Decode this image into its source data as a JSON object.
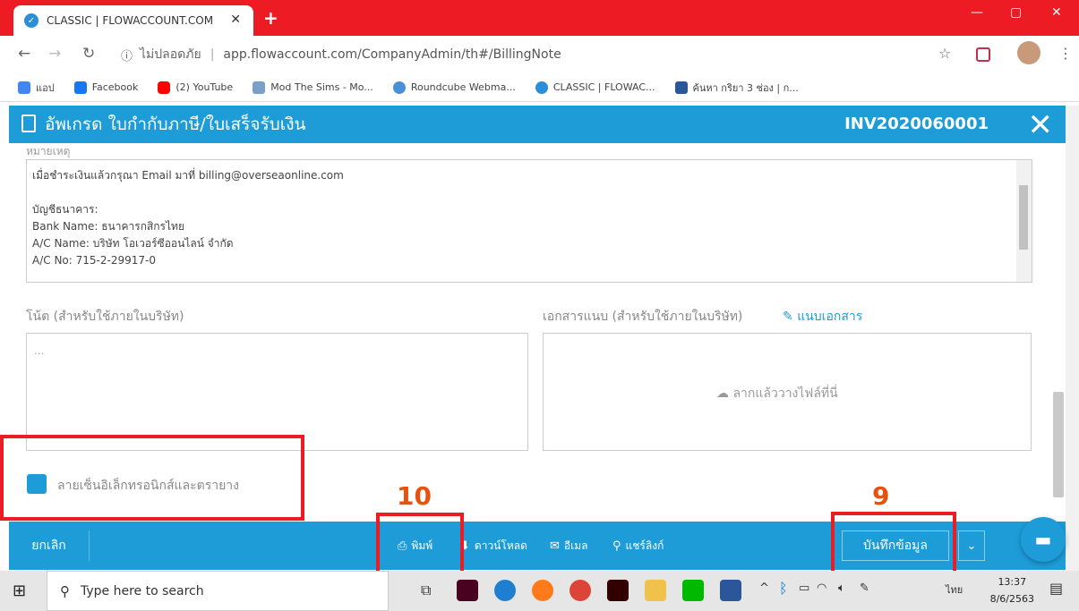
{
  "browser": {
    "tab_title": "CLASSIC | FLOWACCOUNT.COM",
    "tab_close": "✕",
    "new_tab": "+",
    "security_label": "ไม่ปลอดภัย",
    "url": "app.flowaccount.com/CompanyAdmin/th#/BillingNote",
    "bookmarks": [
      "แอป",
      "Facebook",
      "(2) YouTube",
      "Mod The Sims - Mo...",
      "Roundcube Webma...",
      "CLASSIC | FLOWAC...",
      "ค้นหา กริยา 3 ช่อง | ก..."
    ],
    "bookmark_colors": [
      "#4285f4",
      "#1877f2",
      "#ff0000",
      "#7aa0c8",
      "#4a90d9",
      "#2a8fd6",
      "#2b579a"
    ]
  },
  "header": {
    "title": "อัพเกรด ใบกำกับภาษี/ใบเสร็จรับเงิน",
    "doc_number": "INV2020060001",
    "close": "✕"
  },
  "remarks": {
    "label": "หมายเหตุ",
    "lines": [
      "เมื่อชำระเงินแล้วกรุณา Email มาที่ billing@overseaonline.com",
      "",
      "บัญชีธนาคาร:",
      "Bank Name: ธนาคารกสิกรไทย",
      "A/C Name: บริษัท โอเวอร์ซีออนไลน์ จำกัด",
      "A/C No: 715-2-29917-0"
    ]
  },
  "note": {
    "label": "โน้ต (สำหรับใช้ภายในบริษัท)",
    "placeholder": "..."
  },
  "attachment": {
    "label": "เอกสารแนบ (สำหรับใช้ภายในบริษัท)",
    "link": "แนบเอกสาร",
    "drop_text": "ลากแล้ววางไฟล์ที่นี่"
  },
  "signature": {
    "label": "ลายเซ็นอิเล็กทรอนิกส์และตรายาง"
  },
  "annotations": {
    "print_number": "10",
    "save_number": "9"
  },
  "footer": {
    "cancel": "ยกเลิก",
    "print": "พิมพ์",
    "download": "ดาวน์โหลด",
    "email": "อีเมล",
    "share": "แชร์ลิงก์",
    "save": "บันทึกข้อมูล",
    "dropdown": "⌄"
  },
  "taskbar": {
    "search_placeholder": "Type here to search",
    "lang": "ไทย",
    "time": "13:37",
    "date": "8/6/2563"
  },
  "colors": {
    "accent": "#1d9cd8",
    "highlight": "#ea1c24",
    "number": "#e8520e",
    "chrome": "#ed1b24"
  }
}
